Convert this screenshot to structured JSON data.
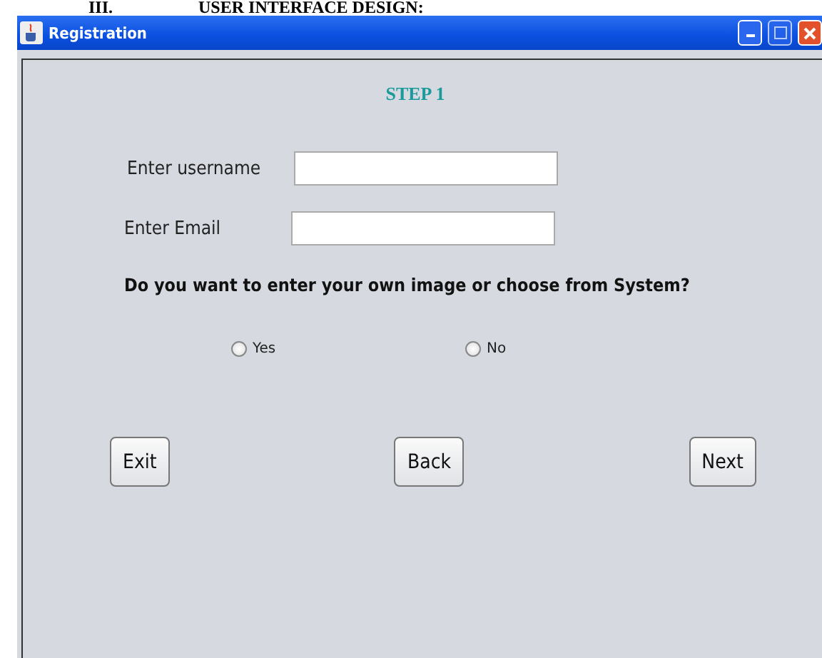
{
  "heading": {
    "number": "III.",
    "title": "USER INTERFACE DESIGN:"
  },
  "window": {
    "title": "Registration"
  },
  "step": "STEP 1",
  "fields": [
    {
      "label": "Enter username"
    },
    {
      "label": "Enter Email"
    }
  ],
  "question": "Do you want to enter your own image or choose from System?",
  "options": [
    {
      "label": "Yes",
      "selected": false
    },
    {
      "label": "No",
      "selected": false
    }
  ],
  "buttons": [
    "Exit",
    "Back",
    "Next"
  ]
}
